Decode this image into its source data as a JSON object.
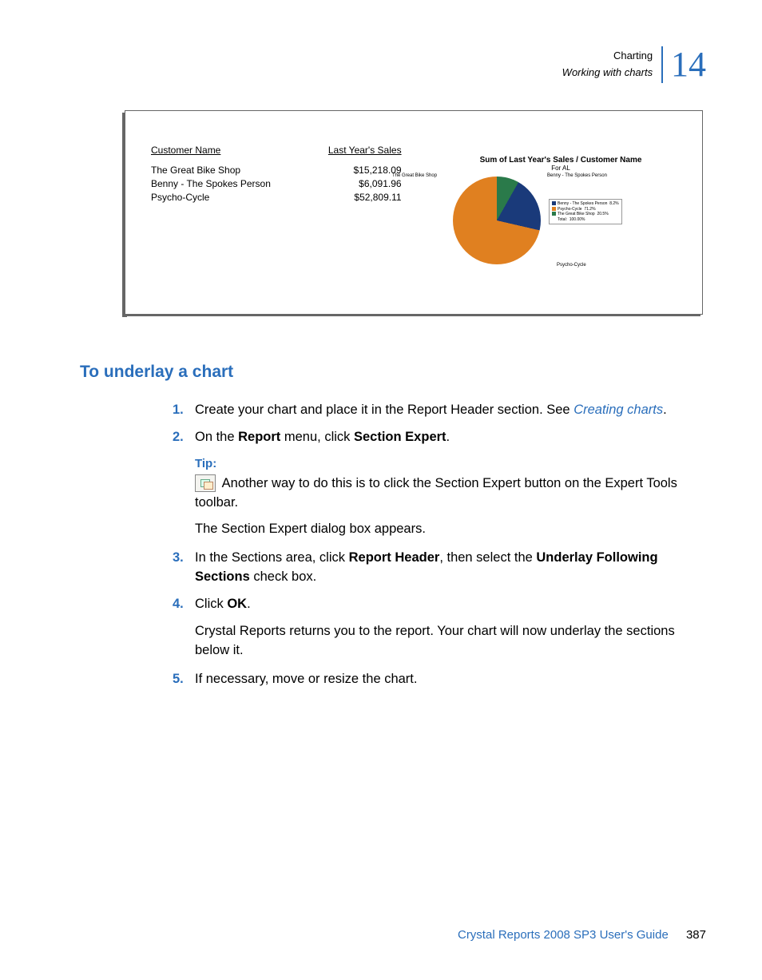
{
  "header": {
    "chapter": "Charting",
    "section": "Working with charts",
    "chapter_num": "14"
  },
  "figure": {
    "col1_header": "Customer Name",
    "col2_header": "Last Year's Sales",
    "rows": [
      {
        "name": "The Great Bike Shop",
        "value": "$15,218.09"
      },
      {
        "name": "Benny - The Spokes Person",
        "value": "$6,091.96"
      },
      {
        "name": "Psycho-Cycle",
        "value": "$52,809.11"
      }
    ],
    "chart_title": "Sum of Last Year's Sales / Customer Name",
    "chart_sub": "For AL",
    "labels": {
      "tl": "The Great Bike Shop",
      "tr": "Benny - The Spokes Person",
      "br": "Psycho-Cycle"
    },
    "legend": [
      {
        "name": "Benny - The Spokes Person",
        "pct": "8.2%",
        "color": "#1a3a7a"
      },
      {
        "name": "Psycho-Cycle",
        "pct": "71.2%",
        "color": "#e08020"
      },
      {
        "name": "The Great Bike Shop",
        "pct": "20.5%",
        "color": "#2a7a4a"
      },
      {
        "name": "Total:",
        "pct": "100.00%",
        "color": ""
      }
    ]
  },
  "chart_data": {
    "type": "pie",
    "title": "Sum of Last Year's Sales / Customer Name",
    "subtitle": "For AL",
    "categories": [
      "Benny - The Spokes Person",
      "Psycho-Cycle",
      "The Great Bike Shop"
    ],
    "values": [
      8.2,
      71.2,
      20.5
    ],
    "unit": "percent",
    "total_label": "Total:",
    "total_value": "100.00%"
  },
  "section_title": "To underlay a chart",
  "steps": {
    "s1_pre": "Create your chart and place it in the Report Header section. See ",
    "s1_link": "Creating charts",
    "s1_post": ".",
    "s2_a": "On the ",
    "s2_b": "Report",
    "s2_c": " menu, click ",
    "s2_d": "Section Expert",
    "s2_e": ".",
    "tip_label": "Tip:",
    "tip_body": " Another way to do this is to click the Section Expert button on the Expert Tools toolbar.",
    "tip_result": "The Section Expert dialog box appears.",
    "s3_a": "In the Sections area, click ",
    "s3_b": "Report Header",
    "s3_c": ", then select the ",
    "s3_d": "Underlay Following Sections",
    "s3_e": " check box.",
    "s4_a": "Click ",
    "s4_b": "OK",
    "s4_c": ".",
    "s4_result": "Crystal Reports returns you to the report. Your chart will now underlay the sections below it.",
    "s5": "If necessary, move or resize the chart."
  },
  "numbers": {
    "n1": "1.",
    "n2": "2.",
    "n3": "3.",
    "n4": "4.",
    "n5": "5."
  },
  "footer": {
    "title": "Crystal Reports 2008 SP3 User's Guide",
    "page": "387"
  }
}
